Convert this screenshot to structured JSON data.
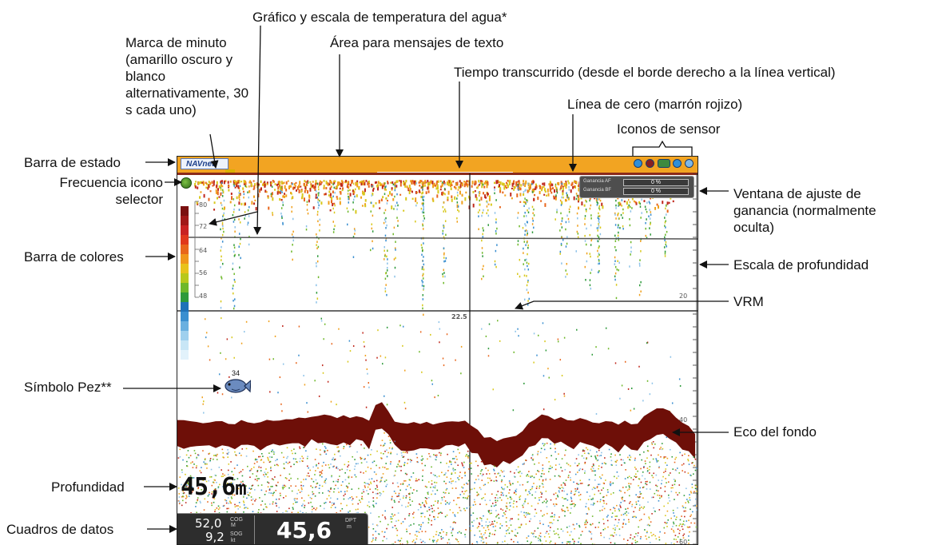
{
  "annotations": {
    "water_temp": "Gráfico y escala de temperatura del agua*",
    "minute_mark": "Marca de minuto (amarillo oscuro y blanco alternativamente, 30 s cada uno)",
    "text_messages": "Área para mensajes de texto",
    "elapsed_time": "Tiempo transcurrido (desde el borde derecho a la línea vertical)",
    "zero_line": "Línea de cero (marrón rojizo)",
    "sensor_icons": "Iconos de sensor",
    "status_bar": "Barra de estado",
    "freq_selector": "Frecuencia icono selector",
    "gain_window": "Ventana de ajuste de ganancia (normalmente oculta)",
    "color_bar": "Barra de colores",
    "depth_scale": "Escala de profundidad",
    "vrm": "VRM",
    "fish_symbol": "Símbolo Pez**",
    "bottom_echo": "Eco del fondo",
    "depth": "Profundidad",
    "data_boxes": "Cuadros de datos"
  },
  "screen": {
    "logo": "NAVnet",
    "gain_rows": [
      {
        "label": "Ganancia AF",
        "value": "0 %"
      },
      {
        "label": "Ganancia BF",
        "value": "0 %"
      }
    ],
    "temp_scale": [
      "80",
      "72",
      "64",
      "56",
      "48"
    ],
    "depth_scale": [
      "20",
      "40",
      "60"
    ],
    "vrm_value": "22.5",
    "fish_depth": "34",
    "depth_value": "45,6",
    "depth_unit": "m",
    "data_boxes": {
      "cog_value": "52,0",
      "cog_label": "COG",
      "cog_unit": "M",
      "sog_value": "9,2",
      "sog_label": "SOG",
      "sog_unit": "kt",
      "dpt_value": "45,6",
      "dpt_label": "DPT",
      "dpt_unit": "m"
    },
    "colors": {
      "status_bar": "#f2a422",
      "zero_line": "#8a2a1a",
      "bottom_echo": "#6e0f08",
      "sensor_icon": "#2f8fd8"
    }
  }
}
